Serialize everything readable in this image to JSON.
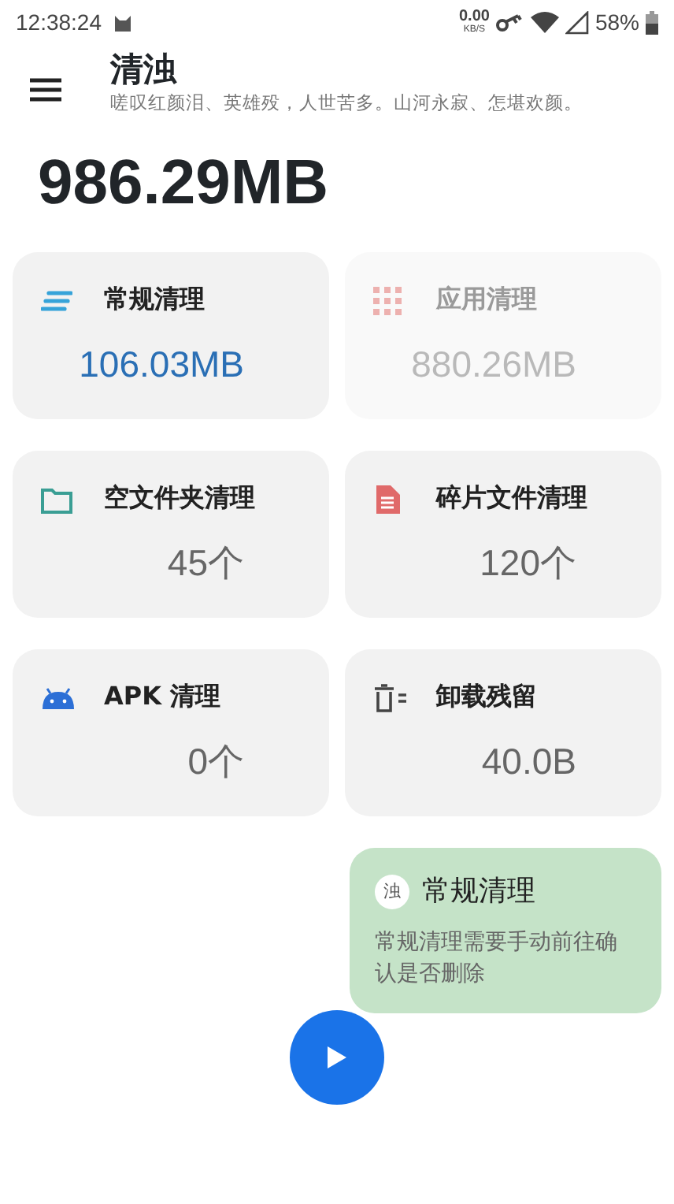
{
  "status_bar": {
    "time": "12:38:24",
    "net_speed": "0.00",
    "net_unit": "KB/S",
    "battery": "58%"
  },
  "header": {
    "title": "清浊",
    "subtitle": "嗟叹红颜泪、英雄殁，人世苦多。山河永寂、怎堪欢颜。"
  },
  "total": "986.29MB",
  "cards": [
    {
      "kind": "general",
      "title": "常规清理",
      "value": "106.03MB",
      "selected": true,
      "disabled": false
    },
    {
      "kind": "apps",
      "title": "应用清理",
      "value": "880.26MB",
      "selected": false,
      "disabled": true
    },
    {
      "kind": "folder",
      "title": "空文件夹清理",
      "value": "45个",
      "selected": false,
      "disabled": false
    },
    {
      "kind": "fragment",
      "title": "碎片文件清理",
      "value": "120个",
      "selected": false,
      "disabled": false
    },
    {
      "kind": "apk",
      "title": "APK 清理",
      "value": "0个",
      "selected": false,
      "disabled": false
    },
    {
      "kind": "residue",
      "title": "卸载残留",
      "value": "40.0B",
      "selected": false,
      "disabled": false
    }
  ],
  "toast": {
    "badge": "浊",
    "title": "常规清理",
    "message": "常规清理需要手动前往确认是否删除"
  }
}
